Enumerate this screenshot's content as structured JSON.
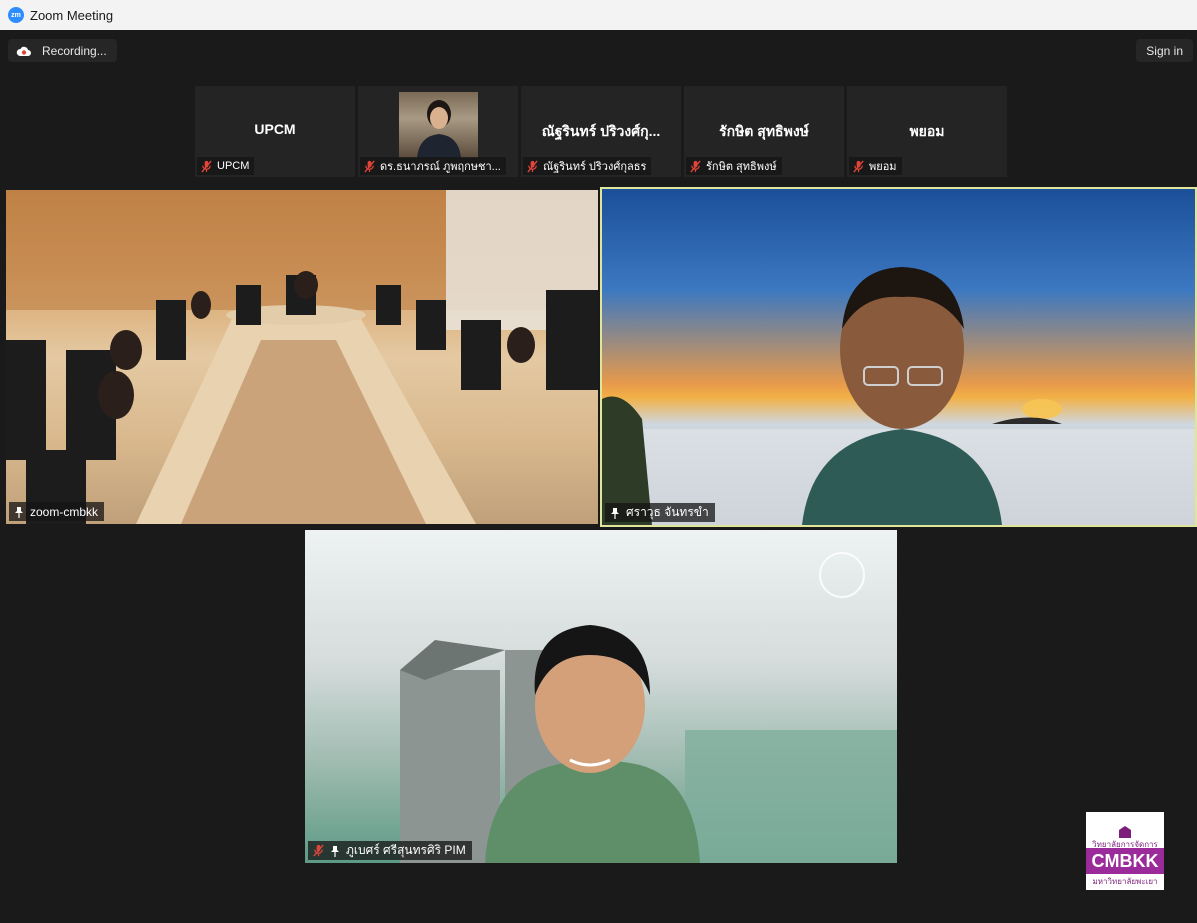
{
  "window": {
    "title": "Zoom Meeting",
    "logo_text": "zm"
  },
  "toolbar": {
    "recording_label": "Recording...",
    "sign_in_label": "Sign in"
  },
  "strip": [
    {
      "display_name": "UPCM",
      "tag": "UPCM",
      "muted": true,
      "has_photo": false
    },
    {
      "display_name": "",
      "tag": "ดร.ธนาภรณ์ ภูพฤกษชา...",
      "muted": true,
      "has_photo": true
    },
    {
      "display_name": "ณัฐรินทร์ ปริวงศ์กุ...",
      "tag": "ณัฐรินทร์ ปริวงศ์กุลธร",
      "muted": true,
      "has_photo": false
    },
    {
      "display_name": "รักษิต สุทธิพงษ์",
      "tag": "รักษิต สุทธิพงษ์",
      "muted": true,
      "has_photo": false
    },
    {
      "display_name": "พยอม",
      "tag": "พยอม",
      "muted": true,
      "has_photo": false
    }
  ],
  "videos": {
    "room": {
      "tag": "zoom-cmbkk",
      "pinned": true,
      "muted": false
    },
    "speaker": {
      "tag": "ศราวุธ จันทรขำ",
      "pinned": true,
      "muted": false,
      "active": true
    },
    "pim": {
      "tag": "ภูเบศร์ ศรีสุนทรศิริ PIM",
      "pinned": true,
      "muted": true
    }
  },
  "watermark": {
    "line1": "วิทยาลัยการจัดการ",
    "brand": "CMBKK",
    "line2": "มหาวิทยาลัยพะเยา"
  },
  "colors": {
    "active_speaker_border": "#dfe59b",
    "muted_icon": "#e0453a",
    "brand_purple": "#9b2a9a"
  }
}
